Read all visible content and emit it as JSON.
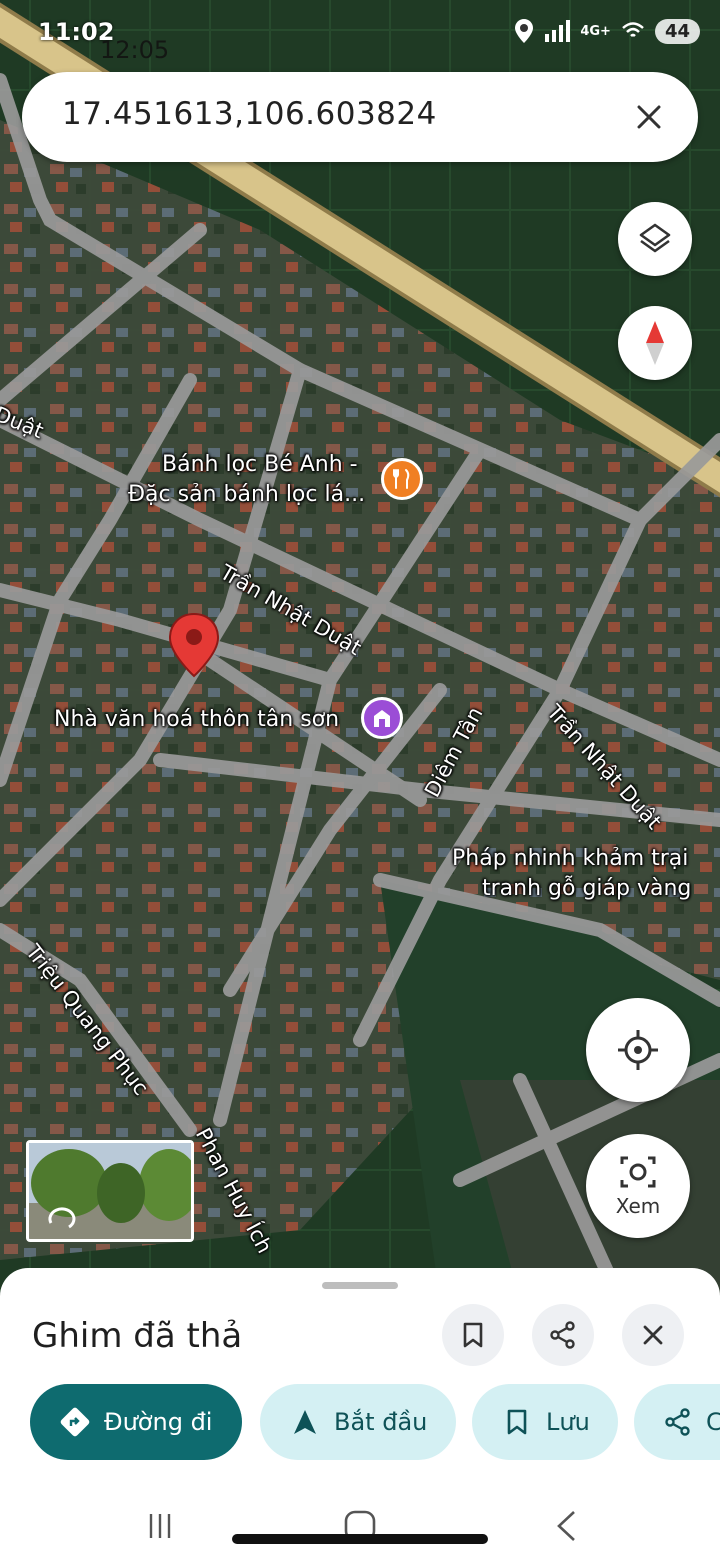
{
  "status_bar": {
    "time": "11:02",
    "time_overlay": "12:05",
    "network": "4G+",
    "battery": "44"
  },
  "search": {
    "value": "17.451613,106.603824"
  },
  "map": {
    "labels": {
      "poi_restaurant_line1": "Bánh lọc Bé Anh -",
      "poi_restaurant_line2": "Đặc sản bánh lọc lá...",
      "road_tran_nhat_duat_1": "Trần Nhật Duật",
      "road_tran_nhat_duat_2": "Trần Nhật Duật",
      "road_duat_edge": "Duật",
      "poi_culture_house": "Nhà văn hoá thôn tân sơn",
      "road_diem_tan": "Diêm Tân",
      "poi_phap_line1": "Pháp nhinh khảm trại",
      "poi_phap_line2": "tranh gỗ giáp vàng",
      "road_trieu_quang_phuc": "Triệu Quang Phục",
      "road_phan_huy_ich": "Phan Huy Ích"
    },
    "icons": {
      "layers": "layers-icon",
      "compass": "compass-icon",
      "pin": "dropped-pin-icon",
      "restaurant": "restaurant-icon",
      "culture": "culture-house-icon"
    },
    "colors": {
      "pin": "#e53935",
      "restaurant_poi": "#f07f23",
      "culture_poi": "#9b4dd6",
      "highway": "#d8c48a"
    }
  },
  "fabs": {
    "view_label": "Xem"
  },
  "sheet": {
    "title": "Ghim đã thả",
    "chips": [
      {
        "label": "Đường đi",
        "icon": "directions-icon"
      },
      {
        "label": "Bắt đầu",
        "icon": "navigation-arrow-icon"
      },
      {
        "label": "Lưu",
        "icon": "bookmark-icon"
      },
      {
        "label": "C",
        "icon": "share-icon"
      }
    ],
    "colors": {
      "primary_chip": "#0e6b6f",
      "secondary_chip": "#d4f0f3"
    }
  }
}
